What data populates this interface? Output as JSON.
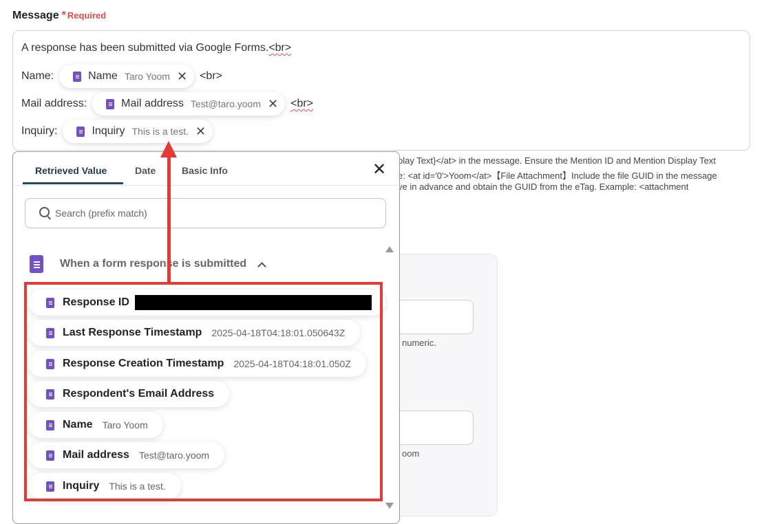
{
  "field": {
    "label": "Message",
    "required_star": "*",
    "required_text": "Required"
  },
  "message": {
    "line1_text": "A response has been submitted via Google Forms.",
    "br": "<br>",
    "name_prefix": "Name:",
    "mail_prefix": "Mail address:",
    "inquiry_prefix": "Inquiry:",
    "chips": [
      {
        "label": "Name",
        "value": "Taro Yoom",
        "icon": "form-doc-icon"
      },
      {
        "label": "Mail address",
        "value": "Test@taro.yoom",
        "icon": "form-doc-icon"
      },
      {
        "label": "Inquiry",
        "value": "This is a test.",
        "icon": "form-doc-icon"
      }
    ],
    "remove_glyph": "✕"
  },
  "help_text": [
    "play Text}</at> in the message. Ensure the Mention ID and Mention Display Text",
    "e: <at id='0'>Yoom</at>【File Attachment】Include the file GUID in the message",
    "ve in advance and obtain the GUID from the eTag. Example: <attachment"
  ],
  "background": {
    "hint1": "numeric.",
    "hint2": "oom"
  },
  "popup": {
    "tabs": [
      "Retrieved Value",
      "Date",
      "Basic Info"
    ],
    "active_tab": "Retrieved Value",
    "close_glyph": "✕",
    "search_placeholder": "Search (prefix match)",
    "group_title": "When a form response is submitted",
    "items": [
      {
        "label": "Response ID",
        "value": "",
        "redacted": true
      },
      {
        "label": "Last Response Timestamp",
        "value": "2025-04-18T04:18:01.050643Z"
      },
      {
        "label": "Response Creation Timestamp",
        "value": "2025-04-18T04:18:01.050Z"
      },
      {
        "label": "Respondent's Email Address",
        "value": ""
      },
      {
        "label": "Name",
        "value": "Taro Yoom"
      },
      {
        "label": "Mail address",
        "value": "Test@taro.yoom"
      },
      {
        "label": "Inquiry",
        "value": "This is a test."
      }
    ]
  },
  "colors": {
    "accent_red": "#e53935",
    "form_purple": "#7350c7",
    "tab_active": "#1f4a66"
  }
}
